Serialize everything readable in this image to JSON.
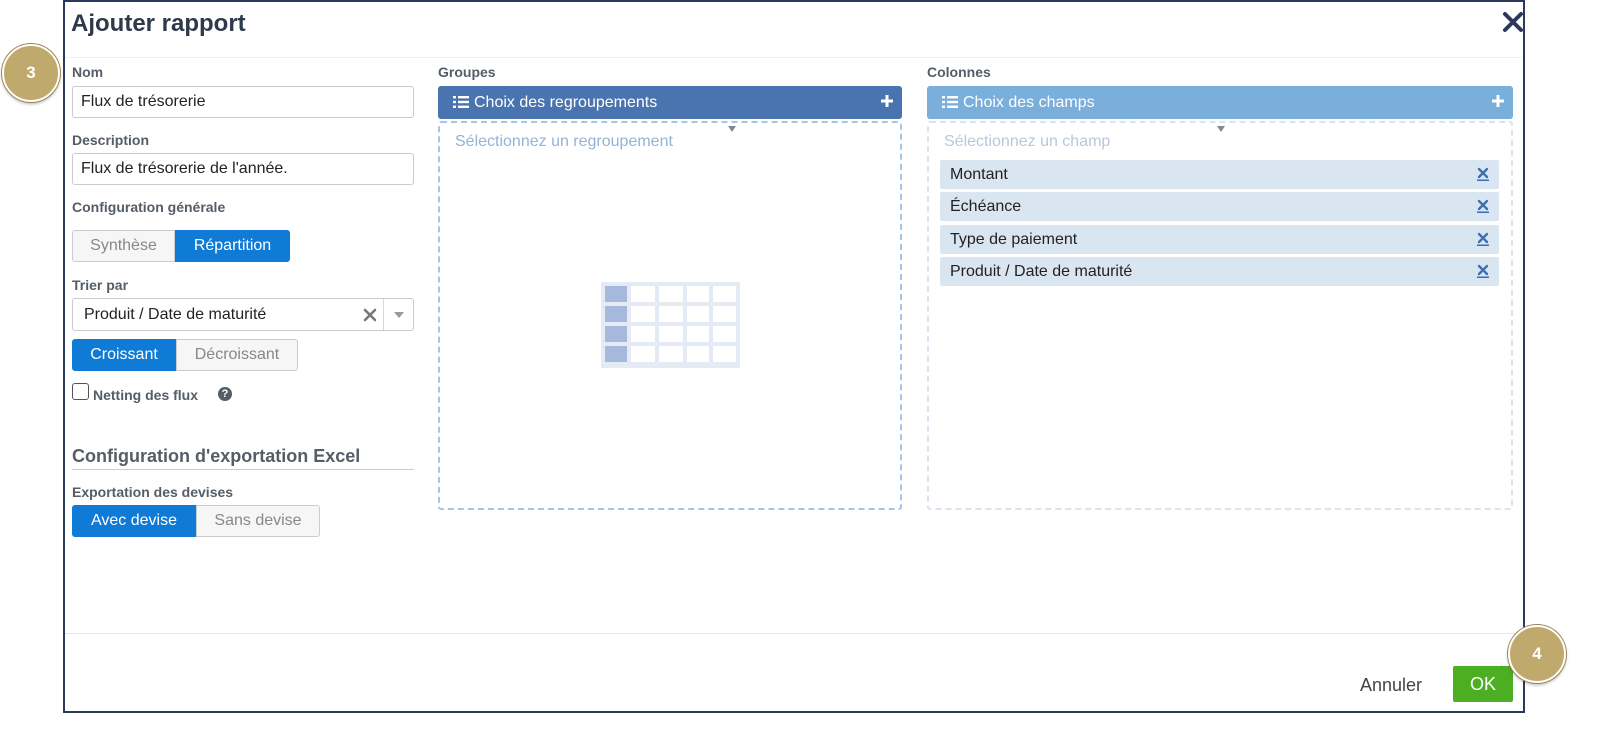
{
  "dialog": {
    "title": "Ajouter rapport"
  },
  "form": {
    "name_label": "Nom",
    "name_value": "Flux de trésorerie",
    "description_label": "Description",
    "description_value": "Flux de trésorerie de l'année.",
    "general_config_label": "Configuration générale",
    "mode_options": [
      {
        "label": "Synthèse",
        "selected": false
      },
      {
        "label": "Répartition",
        "selected": true
      }
    ],
    "sort_label": "Trier par",
    "sort_value": "Produit / Date de maturité",
    "order_options": [
      {
        "label": "Croissant",
        "selected": true
      },
      {
        "label": "Décroissant",
        "selected": false
      }
    ],
    "netting_label": "Netting des flux",
    "netting_checked": false,
    "help_glyph": "?",
    "excel_section_title": "Configuration d'exportation Excel",
    "currency_export_label": "Exportation des devises",
    "currency_options": [
      {
        "label": "Avec devise",
        "selected": true
      },
      {
        "label": "Sans devise",
        "selected": false
      }
    ]
  },
  "groups": {
    "label": "Groupes",
    "header_label": "Choix des regroupements",
    "placeholder": "Sélectionnez un regroupement",
    "empty_icon": "table-placeholder-icon"
  },
  "columns": {
    "label": "Colonnes",
    "header_label": "Choix des champs",
    "placeholder": "Sélectionnez un champ",
    "fields": [
      "Montant",
      "Échéance",
      "Type de paiement",
      "Produit / Date de maturité"
    ]
  },
  "footer": {
    "cancel_label": "Annuler",
    "ok_label": "OK"
  },
  "badges": {
    "step_3": "3",
    "step_4": "4"
  },
  "colors": {
    "primary_blue": "#0f7bd6",
    "groups_header": "#4a74b0",
    "columns_header": "#7aaedb",
    "ok_green": "#4cae22",
    "badge_gold": "#bfa96c"
  }
}
